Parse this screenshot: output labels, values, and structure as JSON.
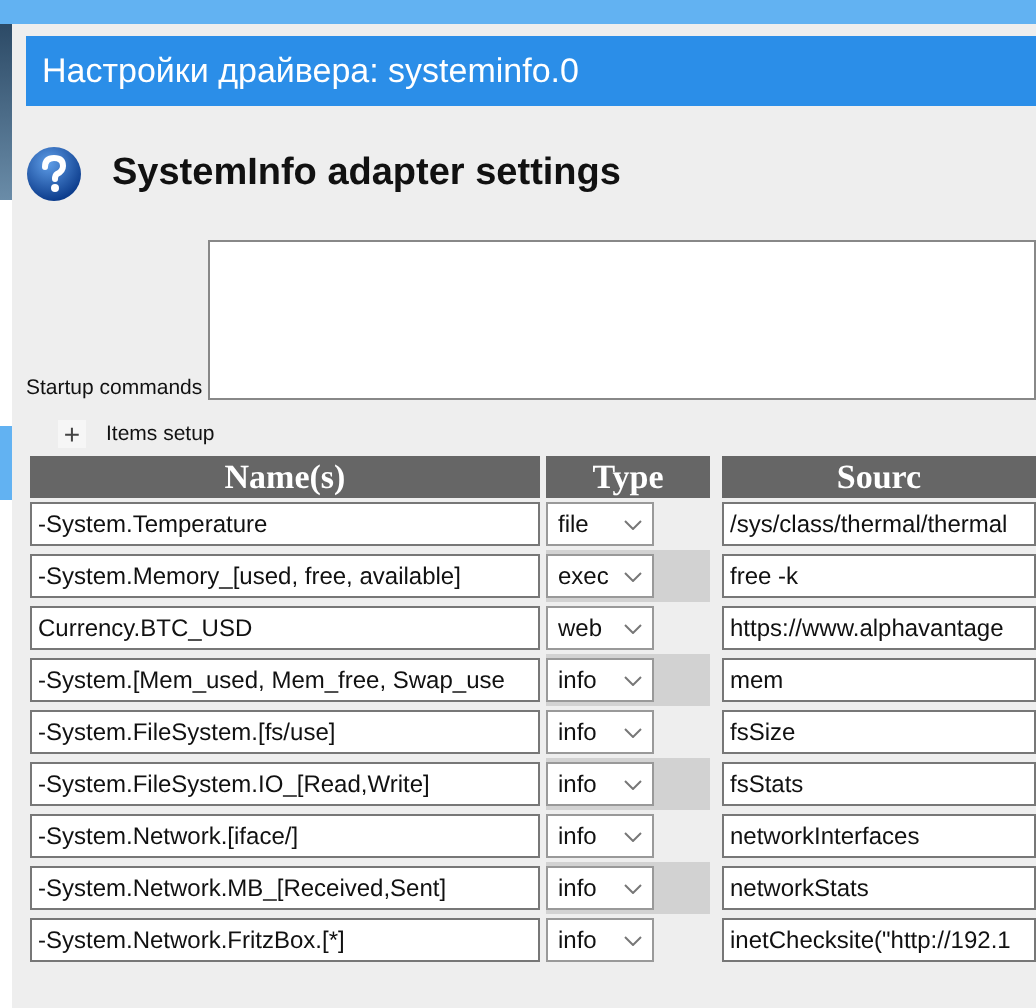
{
  "dialog": {
    "title": "Настройки драйвера: systeminfo.0",
    "heading": "SystemInfo adapter settings"
  },
  "startup": {
    "label": "Startup commands"
  },
  "items_setup": {
    "label": "Items setup",
    "expand_symbol": "+"
  },
  "table": {
    "columns": [
      "Name(s)",
      "Type",
      "Sourc"
    ],
    "rows": [
      {
        "name": "-System.Temperature",
        "type": "file",
        "source": "/sys/class/thermal/thermal"
      },
      {
        "name": "-System.Memory_[used, free, available]",
        "type": "exec",
        "source": "free -k"
      },
      {
        "name": "Currency.BTC_USD",
        "type": "web",
        "source": "https://www.alphavantage"
      },
      {
        "name": "-System.[Mem_used, Mem_free, Swap_use",
        "type": "info",
        "source": "mem"
      },
      {
        "name": "-System.FileSystem.[fs/use]",
        "type": "info",
        "source": "fsSize"
      },
      {
        "name": "-System.FileSystem.IO_[Read,Write]",
        "type": "info",
        "source": "fsStats"
      },
      {
        "name": "-System.Network.[iface/]",
        "type": "info",
        "source": "networkInterfaces"
      },
      {
        "name": "-System.Network.MB_[Received,Sent]",
        "type": "info",
        "source": "networkStats"
      },
      {
        "name": "-System.Network.FritzBox.[*]",
        "type": "info",
        "source": "inetChecksite(\"http://192.1"
      }
    ]
  }
}
